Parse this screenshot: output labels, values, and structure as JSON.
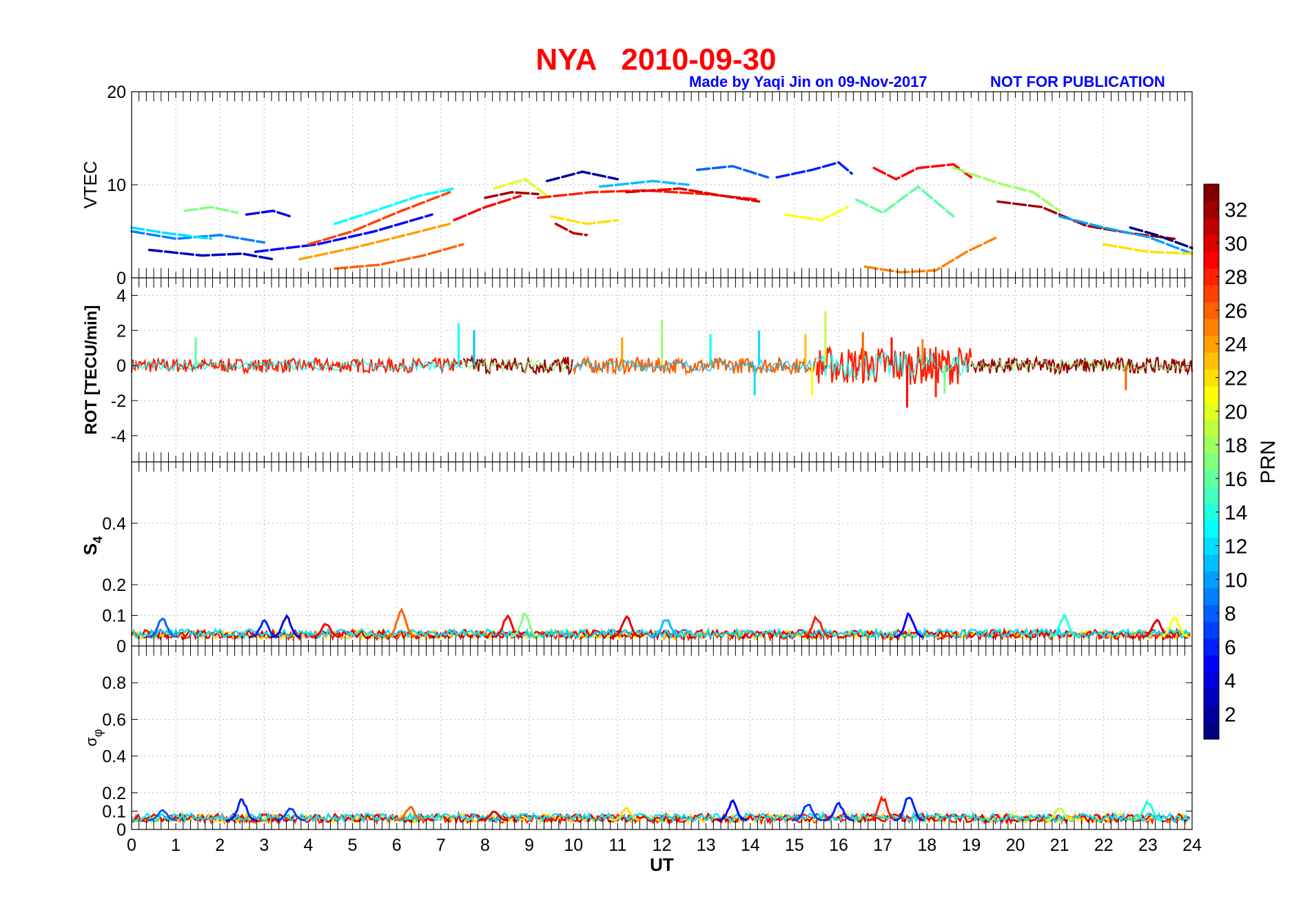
{
  "figure": {
    "title": "NYA   2010-09-30",
    "credit": "Made by Yaqi Jin on 09-Nov-2017",
    "notice": "NOT FOR PUBLICATION"
  },
  "chart_data": [
    {
      "type": "line",
      "panel": "vtec",
      "ylabel": "VTEC",
      "ylim": [
        0,
        20
      ],
      "yticks": [
        "0",
        "10",
        "20"
      ],
      "xlim": [
        0,
        24
      ],
      "grid": true,
      "series": [
        {
          "prn": 3,
          "x": [
            0.4,
            1.6,
            2.5,
            3.2
          ],
          "y": [
            3.0,
            2.4,
            2.6,
            2.0
          ]
        },
        {
          "prn": 5,
          "x": [
            2.8,
            4.2,
            5.5,
            6.8
          ],
          "y": [
            2.8,
            3.6,
            5.0,
            6.8
          ]
        },
        {
          "prn": 9,
          "x": [
            0.0,
            1.0,
            2.0,
            3.0
          ],
          "y": [
            5.0,
            4.2,
            4.6,
            3.8
          ]
        },
        {
          "prn": 12,
          "x": [
            0.0,
            0.8,
            1.8
          ],
          "y": [
            5.4,
            4.8,
            4.2
          ]
        },
        {
          "prn": 17,
          "x": [
            1.2,
            1.8,
            2.4
          ],
          "y": [
            7.2,
            7.6,
            7.0
          ]
        },
        {
          "prn": 4,
          "x": [
            2.6,
            3.2,
            3.6
          ],
          "y": [
            6.8,
            7.2,
            6.6
          ]
        },
        {
          "prn": 13,
          "x": [
            4.6,
            5.5,
            6.5,
            7.3
          ],
          "y": [
            5.8,
            7.2,
            8.8,
            9.6
          ]
        },
        {
          "prn": 27,
          "x": [
            4.0,
            5.0,
            6.0,
            7.2
          ],
          "y": [
            3.6,
            5.0,
            7.0,
            9.2
          ]
        },
        {
          "prn": 24,
          "x": [
            3.8,
            5.0,
            6.2,
            7.2
          ],
          "y": [
            2.0,
            3.2,
            4.6,
            5.8
          ]
        },
        {
          "prn": 26,
          "x": [
            4.6,
            5.6,
            6.6,
            7.5
          ],
          "y": [
            1.0,
            1.4,
            2.4,
            3.6
          ]
        },
        {
          "prn": 29,
          "x": [
            7.3,
            8.0,
            8.8
          ],
          "y": [
            6.2,
            7.6,
            8.8
          ]
        },
        {
          "prn": 32,
          "x": [
            8.0,
            8.6,
            9.2
          ],
          "y": [
            8.6,
            9.2,
            9.0
          ]
        },
        {
          "prn": 20,
          "x": [
            8.2,
            8.9,
            9.4
          ],
          "y": [
            9.6,
            10.6,
            8.8
          ]
        },
        {
          "prn": 2,
          "x": [
            9.4,
            10.2,
            11.0
          ],
          "y": [
            10.4,
            11.4,
            10.6
          ]
        },
        {
          "prn": 31,
          "x": [
            9.6,
            10.0,
            10.3
          ],
          "y": [
            5.8,
            4.8,
            4.6
          ]
        },
        {
          "prn": 22,
          "x": [
            9.5,
            10.3,
            11.0
          ],
          "y": [
            6.6,
            5.8,
            6.2
          ]
        },
        {
          "prn": 28,
          "x": [
            9.2,
            10.4,
            11.6,
            13.0,
            14.2
          ],
          "y": [
            8.6,
            9.2,
            9.4,
            9.0,
            8.4
          ]
        },
        {
          "prn": 11,
          "x": [
            10.6,
            11.8,
            12.6
          ],
          "y": [
            9.8,
            10.4,
            10.0
          ]
        },
        {
          "prn": 8,
          "x": [
            12.8,
            13.6,
            14.4
          ],
          "y": [
            11.6,
            12.0,
            10.8
          ]
        },
        {
          "prn": 30,
          "x": [
            11.2,
            12.4,
            13.4,
            14.2
          ],
          "y": [
            9.2,
            9.6,
            8.8,
            8.2
          ]
        },
        {
          "prn": 6,
          "x": [
            14.6,
            15.4,
            16.0,
            16.3
          ],
          "y": [
            10.8,
            11.6,
            12.4,
            11.2
          ]
        },
        {
          "prn": 21,
          "x": [
            14.8,
            15.6,
            16.2
          ],
          "y": [
            6.8,
            6.2,
            7.6
          ]
        },
        {
          "prn": 16,
          "x": [
            16.4,
            17.0,
            17.8,
            18.6
          ],
          "y": [
            8.4,
            7.0,
            9.8,
            6.6
          ]
        },
        {
          "prn": 29,
          "x": [
            16.8,
            17.3,
            17.8,
            18.6,
            19.0
          ],
          "y": [
            11.8,
            10.6,
            11.8,
            12.2,
            10.8
          ]
        },
        {
          "prn": 25,
          "x": [
            16.6,
            17.4,
            18.2,
            18.9,
            19.6
          ],
          "y": [
            1.2,
            0.6,
            0.8,
            2.8,
            4.4
          ]
        },
        {
          "prn": 18,
          "x": [
            18.6,
            19.6,
            20.4,
            21.0
          ],
          "y": [
            11.8,
            10.2,
            9.2,
            7.2
          ]
        },
        {
          "prn": 32,
          "x": [
            19.6,
            20.6,
            21.6,
            22.6,
            23.6
          ],
          "y": [
            8.2,
            7.6,
            5.6,
            4.8,
            4.2
          ]
        },
        {
          "prn": 10,
          "x": [
            21.0,
            22.0,
            23.0,
            24.0
          ],
          "y": [
            6.6,
            5.4,
            4.4,
            2.6
          ]
        },
        {
          "prn": 22,
          "x": [
            22.0,
            23.0,
            24.0
          ],
          "y": [
            3.6,
            2.8,
            2.6
          ]
        },
        {
          "prn": 1,
          "x": [
            22.6,
            23.2,
            24.0
          ],
          "y": [
            5.4,
            4.6,
            3.2
          ]
        }
      ]
    },
    {
      "type": "line",
      "panel": "rot",
      "ylabel": "ROT [TECU/min]",
      "ylim": [
        -5.5,
        5
      ],
      "yticks": [
        "-4",
        "-2",
        "0",
        "2",
        "4"
      ],
      "xlim": [
        0,
        24
      ],
      "grid": true,
      "baseline": 0,
      "noise_bands": [
        {
          "x": [
            0,
            7.5
          ],
          "amp": 0.4,
          "prn": 28
        },
        {
          "x": [
            7.5,
            10
          ],
          "amp": 0.5,
          "prn": 32
        },
        {
          "x": [
            10,
            15.5
          ],
          "amp": 0.45,
          "prn": 26
        },
        {
          "x": [
            15.5,
            19
          ],
          "amp": 1.1,
          "prn": 28
        },
        {
          "x": [
            19,
            24
          ],
          "amp": 0.45,
          "prn": 32
        }
      ],
      "spikes": [
        {
          "x": 1.45,
          "y": 1.6,
          "prn": 16
        },
        {
          "x": 7.4,
          "y": 2.4,
          "prn": 13
        },
        {
          "x": 7.75,
          "y": 2.0,
          "prn": 11
        },
        {
          "x": 11.1,
          "y": 1.6,
          "prn": 24
        },
        {
          "x": 12.0,
          "y": 2.6,
          "prn": 18
        },
        {
          "x": 13.1,
          "y": 1.8,
          "prn": 13
        },
        {
          "x": 14.2,
          "y": 2.0,
          "prn": 12
        },
        {
          "x": 15.25,
          "y": 1.8,
          "prn": 23
        },
        {
          "x": 15.7,
          "y": 3.1,
          "prn": 19
        },
        {
          "x": 16.55,
          "y": 1.9,
          "prn": 26
        },
        {
          "x": 17.2,
          "y": 1.6,
          "prn": 29
        },
        {
          "x": 17.55,
          "y": -2.4,
          "prn": 29
        },
        {
          "x": 17.9,
          "y": 1.5,
          "prn": 25
        },
        {
          "x": 18.2,
          "y": -1.8,
          "prn": 28
        },
        {
          "x": 18.4,
          "y": -1.6,
          "prn": 17
        },
        {
          "x": 15.4,
          "y": -1.7,
          "prn": 21
        },
        {
          "x": 14.1,
          "y": -1.7,
          "prn": 12
        },
        {
          "x": 22.5,
          "y": -1.4,
          "prn": 26
        }
      ]
    },
    {
      "type": "line",
      "panel": "s4",
      "ylabel": "S4",
      "ylim": [
        0,
        0.6
      ],
      "yticks": [
        "0",
        "0.1",
        "0.2",
        "0.4"
      ],
      "xlim": [
        0,
        24
      ],
      "grid": true,
      "background_level": 0.03,
      "bursts": [
        {
          "x": 0.7,
          "y": 0.095,
          "prn": 8
        },
        {
          "x": 3.0,
          "y": 0.085,
          "prn": 6
        },
        {
          "x": 3.5,
          "y": 0.1,
          "prn": 4
        },
        {
          "x": 4.4,
          "y": 0.075,
          "prn": 29
        },
        {
          "x": 6.1,
          "y": 0.125,
          "prn": 26
        },
        {
          "x": 8.5,
          "y": 0.1,
          "prn": 29
        },
        {
          "x": 8.9,
          "y": 0.11,
          "prn": 17
        },
        {
          "x": 11.2,
          "y": 0.1,
          "prn": 30
        },
        {
          "x": 12.1,
          "y": 0.095,
          "prn": 11
        },
        {
          "x": 15.5,
          "y": 0.1,
          "prn": 28
        },
        {
          "x": 17.6,
          "y": 0.11,
          "prn": 5
        },
        {
          "x": 21.1,
          "y": 0.105,
          "prn": 14
        },
        {
          "x": 23.2,
          "y": 0.09,
          "prn": 30
        },
        {
          "x": 23.6,
          "y": 0.1,
          "prn": 21
        }
      ]
    },
    {
      "type": "line",
      "panel": "sigma_phi",
      "ylabel": "σφ",
      "ylim": [
        0,
        1
      ],
      "yticks": [
        "0",
        "0.1",
        "0.2",
        "0.4",
        "0.6",
        "0.8"
      ],
      "xlim": [
        0,
        24
      ],
      "xlabel": "UT",
      "xticks": [
        "0",
        "1",
        "2",
        "3",
        "4",
        "5",
        "6",
        "7",
        "8",
        "9",
        "10",
        "11",
        "12",
        "13",
        "14",
        "15",
        "16",
        "17",
        "18",
        "19",
        "20",
        "21",
        "22",
        "23",
        "24"
      ],
      "grid": true,
      "background_level": 0.05,
      "bursts": [
        {
          "x": 0.7,
          "y": 0.11,
          "prn": 8
        },
        {
          "x": 2.5,
          "y": 0.17,
          "prn": 6
        },
        {
          "x": 3.6,
          "y": 0.12,
          "prn": 7
        },
        {
          "x": 6.3,
          "y": 0.13,
          "prn": 26
        },
        {
          "x": 8.2,
          "y": 0.1,
          "prn": 30
        },
        {
          "x": 11.2,
          "y": 0.12,
          "prn": 22
        },
        {
          "x": 13.6,
          "y": 0.16,
          "prn": 5
        },
        {
          "x": 15.3,
          "y": 0.15,
          "prn": 7
        },
        {
          "x": 16.0,
          "y": 0.15,
          "prn": 6
        },
        {
          "x": 17.0,
          "y": 0.18,
          "prn": 28
        },
        {
          "x": 17.6,
          "y": 0.2,
          "prn": 6
        },
        {
          "x": 21.0,
          "y": 0.12,
          "prn": 19
        },
        {
          "x": 23.0,
          "y": 0.16,
          "prn": 14
        }
      ]
    }
  ],
  "colorbar": {
    "label": "PRN",
    "ticks": [
      "2",
      "4",
      "6",
      "8",
      "10",
      "12",
      "14",
      "16",
      "18",
      "20",
      "22",
      "24",
      "26",
      "28",
      "30",
      "32"
    ],
    "range": [
      1,
      33
    ],
    "colormap": "jet"
  }
}
